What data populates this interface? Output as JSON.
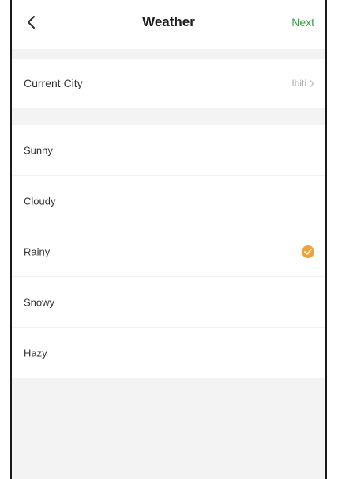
{
  "header": {
    "title": "Weather",
    "next_label": "Next"
  },
  "city": {
    "label": "Current City",
    "value": "Ibiti"
  },
  "weather_options": [
    {
      "label": "Sunny",
      "selected": false
    },
    {
      "label": "Cloudy",
      "selected": false
    },
    {
      "label": "Rainy",
      "selected": true
    },
    {
      "label": "Snowy",
      "selected": false
    },
    {
      "label": "Hazy",
      "selected": false
    }
  ],
  "colors": {
    "accent": "#f0a23a",
    "next": "#3a9a4a"
  }
}
